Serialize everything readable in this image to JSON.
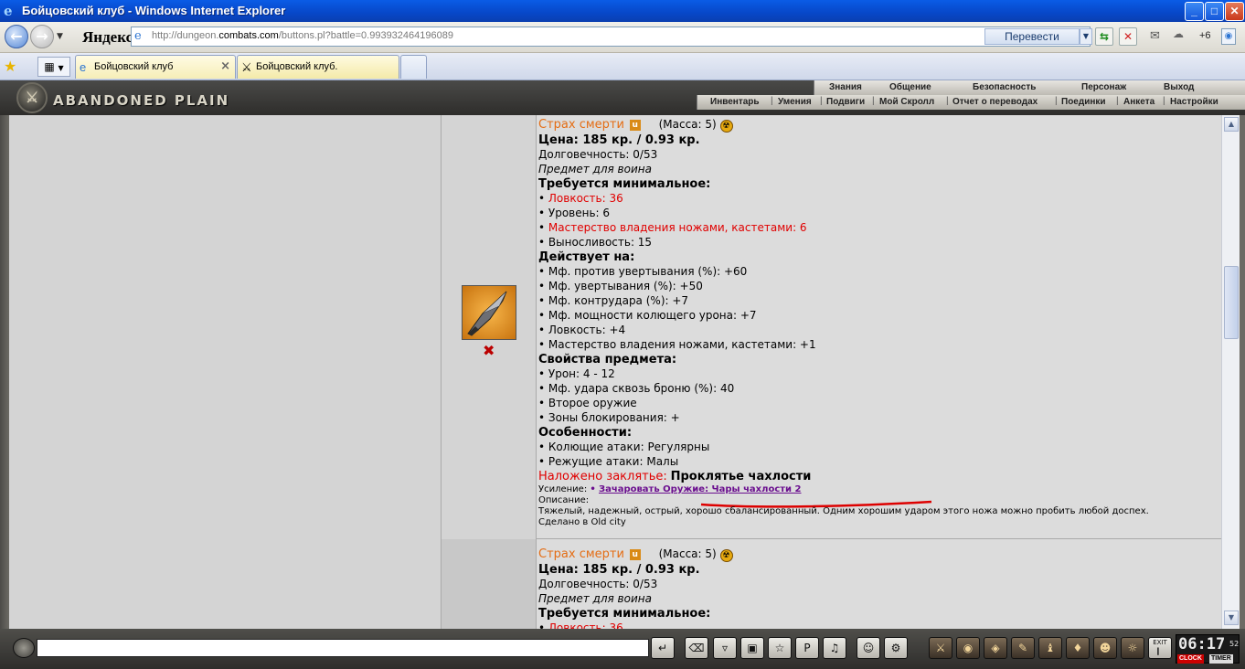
{
  "window": {
    "title": "Бойцовский клуб - Windows Internet Explorer",
    "minimize": "_",
    "maximize": "□",
    "close": "✕"
  },
  "address_bar": {
    "search_brand": "Яндекс",
    "url_prefix": "http://dungeon.",
    "url_domain": "combats.com",
    "url_suffix": "/buttons.pl?battle=0.993932464196089",
    "translate_label": "Перевести",
    "weather": "+6"
  },
  "tabs": [
    {
      "label": "Бойцовский клуб",
      "active": true
    },
    {
      "label": "Бойцовский клуб.",
      "active": false
    }
  ],
  "game_header": {
    "logo_text": "ABANDONED PLAIN",
    "menu_top": [
      "Знания",
      "Общение",
      "Безопасность",
      "Персонаж",
      "Выход"
    ],
    "menu_bottom": [
      "Инвентарь",
      "Умения",
      "Подвиги",
      "Мой Скролл",
      "Отчет о переводах",
      "Поединки",
      "Анкета",
      "Настройки"
    ]
  },
  "item": {
    "name": "Страх смерти",
    "mass": "(Масса: 5)",
    "price": "Цена: 185 кр. / 0.93 кр.",
    "durability": "Долговечность: 0/53",
    "class_note": "Предмет для воина",
    "req_header": "Требуется минимальное:",
    "requirements": [
      {
        "text": "Ловкость: 36",
        "unmet": true
      },
      {
        "text": "Уровень: 6",
        "unmet": false
      },
      {
        "text": "Мастерство владения ножами, кастетами: 6",
        "unmet": true
      },
      {
        "text": "Выносливость: 15",
        "unmet": false
      }
    ],
    "effects_header": "Действует на:",
    "effects": [
      "Мф. против увертывания (%): +60",
      "Мф. увертывания (%): +50",
      "Мф. контрудара (%): +7",
      "Мф. мощности колющего урона: +7",
      "Ловкость: +4",
      "Мастерство владения ножами, кастетами: +1"
    ],
    "props_header": "Свойства предмета:",
    "props": [
      "Урон: 4 - 12",
      "Мф. удара сквозь броню (%): 40",
      "Второе оружие",
      "Зоны блокирования: +"
    ],
    "features_header": "Особенности:",
    "features": [
      "Колющие атаки: Регулярны",
      "Режущие атаки: Малы"
    ],
    "spell_label": "Наложено заклятье:",
    "spell_value": "Проклятье чахлости",
    "boost_label": "Усиление:",
    "boost_link": "Зачаровать Оружие: Чары чахлости 2",
    "desc_label": "Описание:",
    "description": "Тяжелый, надежный, острый, хорошо сбалансированный. Одним хорошим ударом этого ножа можно пробить любой доспех.",
    "made_in": "Сделано в Old city"
  },
  "next_item": {
    "name": "Страх смерти",
    "mass": "(Масса: 5)",
    "price": "Цена: 185 кр. / 0.93 кр.",
    "durability": "Долговечность: 0/53",
    "class_note": "Предмет для воина",
    "req_header": "Требуется минимальное:",
    "first_req": "Ловкость: 36"
  },
  "clock": {
    "time": "06:17",
    "seconds": "52",
    "clock_label": "CLOCK",
    "timer_label": "TIMER",
    "exit_label": "EXIT"
  },
  "colors": {
    "unmet_requirement": "#e00000",
    "item_name": "#e46d14",
    "enchant_link": "#6b0f8f"
  }
}
